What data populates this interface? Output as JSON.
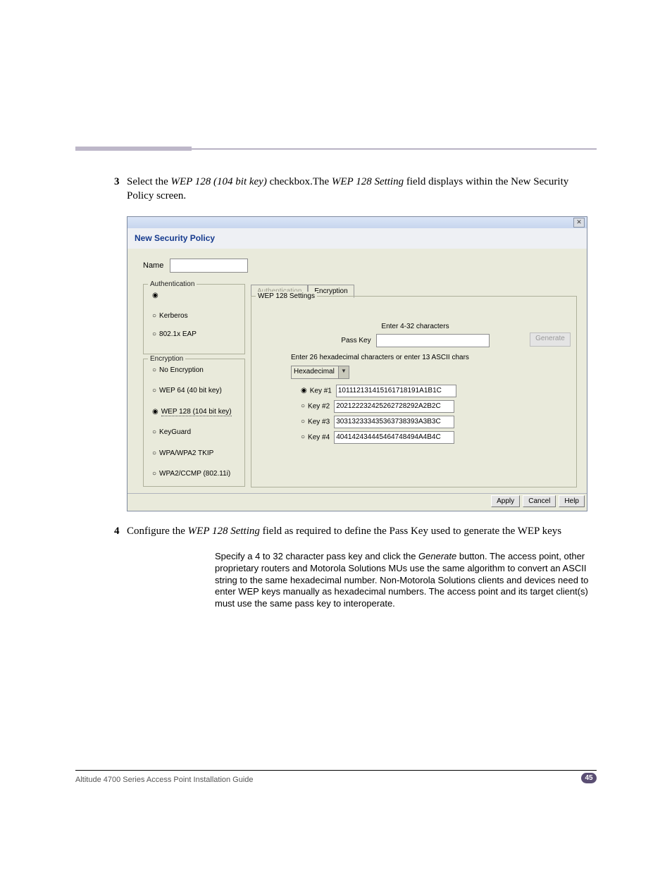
{
  "step3": {
    "num": "3",
    "pre": "Select the ",
    "italic1": "WEP 128 (104 bit key)",
    "mid": " checkbox.The ",
    "italic2": "WEP 128 Setting",
    "post": " field displays within the New Security Policy screen."
  },
  "dialog": {
    "title": "New Security Policy",
    "name_label": "Name",
    "auth": {
      "legend": "Authentication",
      "opt_blank": "",
      "opt_kerberos": "Kerberos",
      "opt_8021x": "802.1x EAP"
    },
    "enc": {
      "legend": "Encryption",
      "none": "No Encryption",
      "wep64": "WEP 64 (40 bit key)",
      "wep128": "WEP 128 (104 bit key)",
      "keyguard": "KeyGuard",
      "wpa": "WPA/WPA2 TKIP",
      "wpa2": "WPA2/CCMP (802.11i)"
    },
    "tabs": {
      "auth": "Authentication",
      "enc": "Encryption"
    },
    "wep": {
      "legend": "WEP 128 Settings",
      "enter_chars": "Enter 4-32 characters",
      "passkey_label": "Pass Key",
      "generate": "Generate",
      "hex_hint": "Enter 26 hexadecimal characters or enter 13 ASCII chars",
      "hex_select": "Hexadecimal",
      "keys": [
        {
          "label": "Key #1",
          "value": "101112131415161718191A1B1C"
        },
        {
          "label": "Key #2",
          "value": "202122232425262728292A2B2C"
        },
        {
          "label": "Key #3",
          "value": "303132333435363738393A3B3C"
        },
        {
          "label": "Key #4",
          "value": "404142434445464748494A4B4C"
        }
      ]
    },
    "buttons": {
      "apply": "Apply",
      "cancel": "Cancel",
      "help": "Help"
    }
  },
  "step4": {
    "num": "4",
    "pre": "Configure the ",
    "italic": "WEP 128 Setting",
    "post": " field as required to define the Pass Key used to generate the WEP keys"
  },
  "desc": {
    "line1": "Specify a 4 to 32 character pass key and click the ",
    "gen": "Generate",
    "rest": " button. The access point, other proprietary routers and Motorola Solutions MUs use the same algorithm to convert an ASCII string to the same hexadecimal number. Non-Motorola Solutions clients and devices need to enter WEP keys manually as hexadecimal numbers. The access point and its target client(s) must use the same pass key to interoperate."
  },
  "footer": {
    "text": "Altitude 4700 Series Access Point Installation Guide",
    "page": "45"
  }
}
